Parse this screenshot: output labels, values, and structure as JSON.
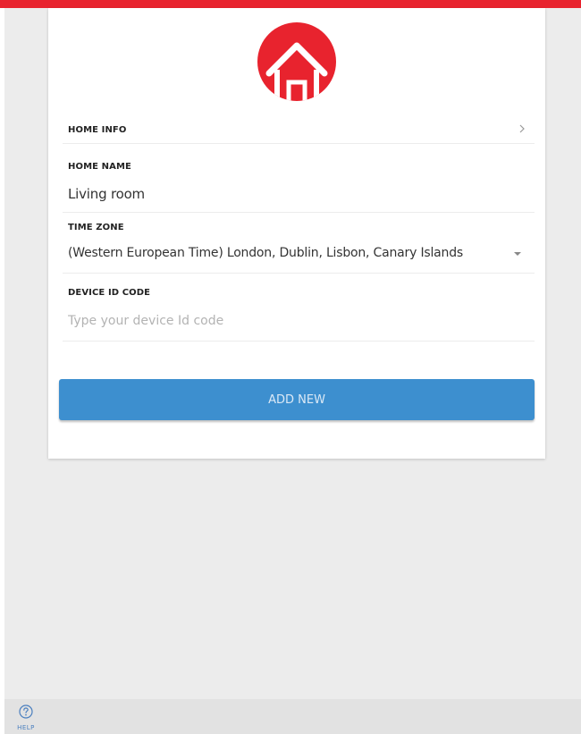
{
  "colors": {
    "accent": "#e8232e",
    "button": "#3d8fcf",
    "background": "#ececec"
  },
  "logo": {
    "icon": "home-icon"
  },
  "home_info": {
    "label": "HOME INFO",
    "icon": "chevron-right-icon"
  },
  "home_name": {
    "label": "HOME NAME",
    "value": "Living room"
  },
  "time_zone": {
    "label": "TIME ZONE",
    "value": "(Western European Time) London, Dublin, Lisbon, Canary Islands",
    "icon": "dropdown-arrow-icon"
  },
  "device_id": {
    "label": "DEVICE ID CODE",
    "placeholder": "Type your device Id code",
    "value": ""
  },
  "add_button": {
    "label": "ADD NEW"
  },
  "help": {
    "label": "HELP",
    "icon": "question-circle-icon"
  }
}
